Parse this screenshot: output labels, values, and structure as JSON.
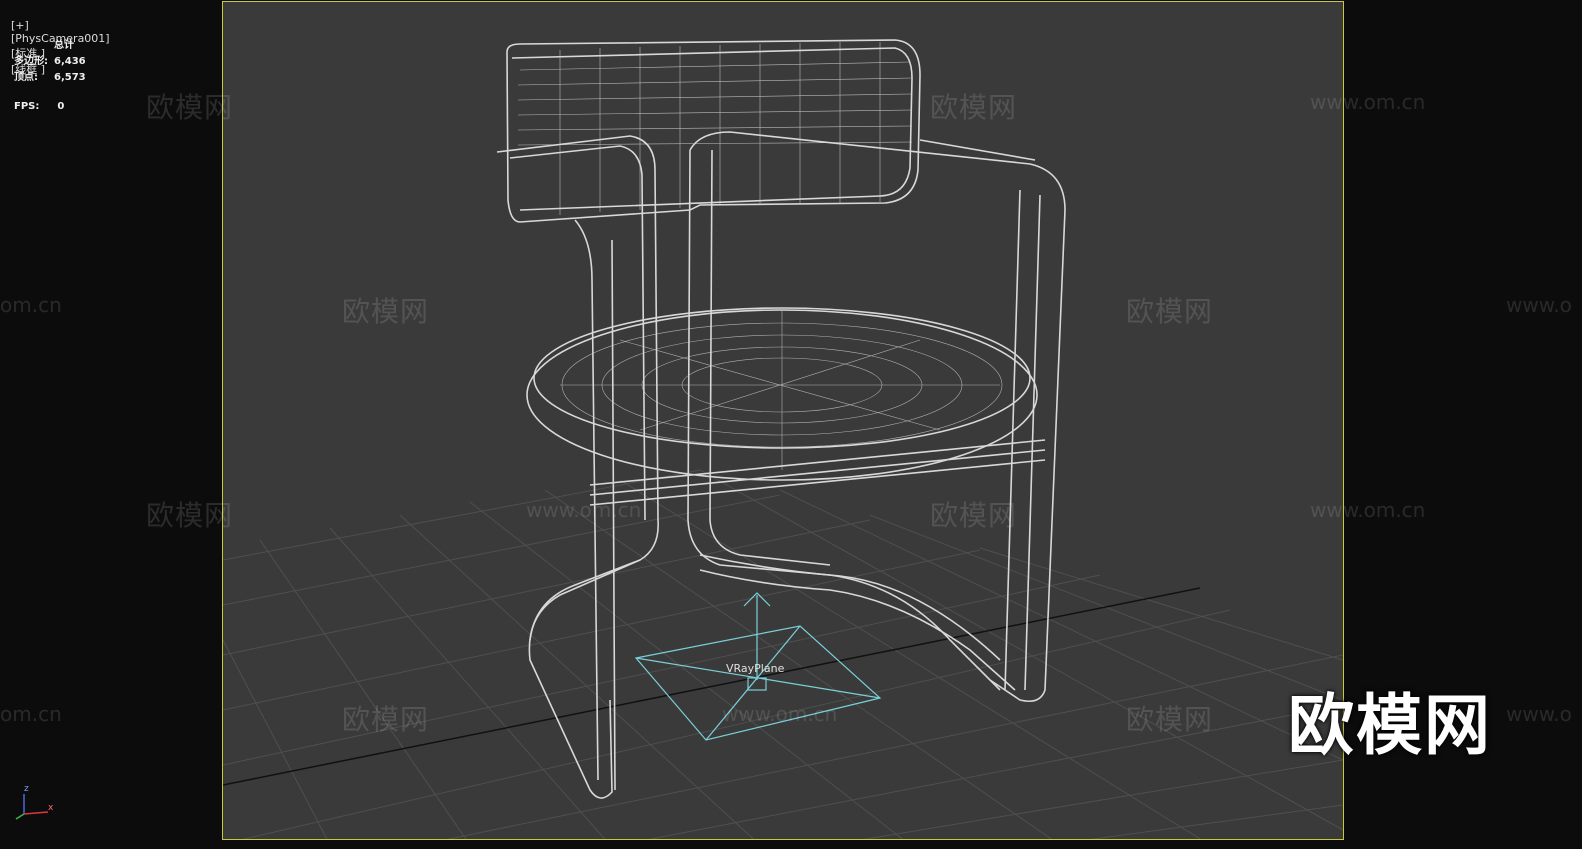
{
  "viewport": {
    "labels": [
      "[+]",
      "[PhysCamera001]",
      "[标准 ]",
      "[线框 ]"
    ]
  },
  "stats": {
    "header": "总计",
    "polygons_label": "多边形:",
    "polygons_value": "6,436",
    "vertices_label": "顶点:",
    "vertices_value": "6,573",
    "fps_label": "FPS:",
    "fps_value": "0"
  },
  "scene": {
    "object_label": "VRayPlane"
  },
  "axis": {
    "x": "x",
    "z": "z"
  },
  "watermarks": {
    "brand": "欧模网",
    "url": "www.om.cn",
    "url_partial_left": "om.cn",
    "url_partial_right": "www.o",
    "big": "欧模网"
  },
  "colors": {
    "background": "#0c0c0c",
    "viewport_bg": "#3a3a3a",
    "frame_border": "#c8c83c",
    "wireframe": "#d8d8d8",
    "grid": "#4e4e4e",
    "gizmo": "#7ad0d8"
  }
}
